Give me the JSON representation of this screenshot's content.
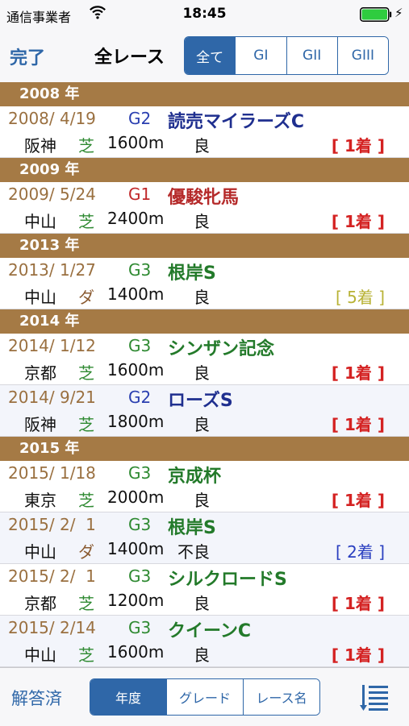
{
  "status": {
    "carrier": "通信事業者",
    "time": "18:45"
  },
  "nav": {
    "done_label": "完了",
    "title": "全レース",
    "grade_filter": [
      "全て",
      "GI",
      "GII",
      "GIII"
    ],
    "grade_selected": 0
  },
  "sections": [
    {
      "year": "2008 年",
      "races": [
        {
          "date": "2008/ 4/19",
          "grade": "G2",
          "name": "読売マイラーズC",
          "venue": "阪神",
          "surface": "芝",
          "distance": "1600m",
          "condition": "良",
          "result": "[ 1着 ]",
          "result_style": "win"
        }
      ]
    },
    {
      "year": "2009 年",
      "races": [
        {
          "date": "2009/ 5/24",
          "grade": "G1",
          "name": "優駿牝馬",
          "venue": "中山",
          "surface": "芝",
          "distance": "2400m",
          "condition": "良",
          "result": "[ 1着 ]",
          "result_style": "win"
        }
      ]
    },
    {
      "year": "2013 年",
      "races": [
        {
          "date": "2013/ 1/27",
          "grade": "G3",
          "name": "根岸S",
          "venue": "中山",
          "surface": "ダ",
          "distance": "1400m",
          "condition": "良",
          "result": "[ 5着 ]",
          "result_style": "olive"
        }
      ]
    },
    {
      "year": "2014 年",
      "races": [
        {
          "date": "2014/ 1/12",
          "grade": "G3",
          "name": "シンザン記念",
          "venue": "京都",
          "surface": "芝",
          "distance": "1600m",
          "condition": "良",
          "result": "[ 1着 ]",
          "result_style": "win"
        },
        {
          "date": "2014/ 9/21",
          "grade": "G2",
          "name": "ローズS",
          "venue": "阪神",
          "surface": "芝",
          "distance": "1800m",
          "condition": "良",
          "result": "[ 1着 ]",
          "result_style": "win"
        }
      ]
    },
    {
      "year": "2015 年",
      "races": [
        {
          "date": "2015/ 1/18",
          "grade": "G3",
          "name": "京成杯",
          "venue": "東京",
          "surface": "芝",
          "distance": "2000m",
          "condition": "良",
          "result": "[ 1着 ]",
          "result_style": "win"
        },
        {
          "date": "2015/ 2/  1",
          "grade": "G3",
          "name": "根岸S",
          "venue": "中山",
          "surface": "ダ",
          "distance": "1400m",
          "condition": "不良",
          "result": "[ 2着 ]",
          "result_style": "blue"
        },
        {
          "date": "2015/ 2/  1",
          "grade": "G3",
          "name": "シルクロードS",
          "venue": "京都",
          "surface": "芝",
          "distance": "1200m",
          "condition": "良",
          "result": "[ 1着 ]",
          "result_style": "win"
        },
        {
          "date": "2015/ 2/14",
          "grade": "G3",
          "name": "クイーンC",
          "venue": "中山",
          "surface": "芝",
          "distance": "1600m",
          "condition": "良",
          "result": "[ 1着 ]",
          "result_style": "win"
        }
      ]
    }
  ],
  "toolbar": {
    "answered_label": "解答済",
    "sort_options": [
      "年度",
      "グレード",
      "レース名"
    ],
    "sort_selected": 0
  },
  "colors": {
    "accent": "#2f67a8",
    "year_header": "#a57a45",
    "date": "#9a7040",
    "g1": "#c0282a",
    "g2": "#2a3fb0",
    "g3": "#2f8a32",
    "win": "#d42222"
  },
  "icons": {
    "wifi": "wifi-icon",
    "battery": "battery-icon",
    "charging": "bolt-icon",
    "list": "list-view-icon"
  }
}
